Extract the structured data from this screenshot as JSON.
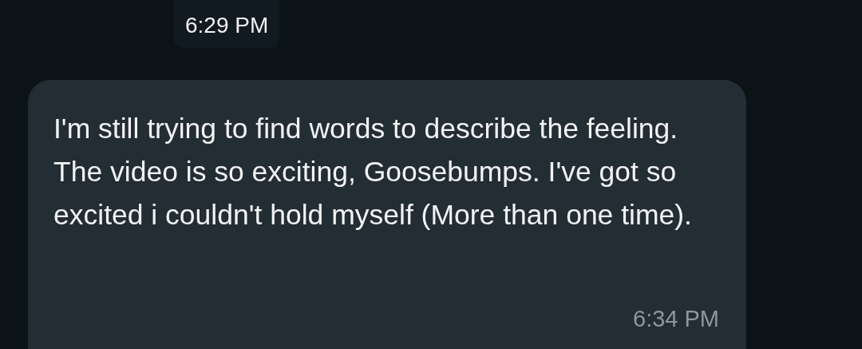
{
  "previous_message": {
    "time": "6:29 PM"
  },
  "message": {
    "text": "I'm still trying to find words to describe the feeling. The video is so exciting, Goosebumps. I've got so excited i couldn't hold myself (More than one time).",
    "time": "6:34 PM"
  }
}
